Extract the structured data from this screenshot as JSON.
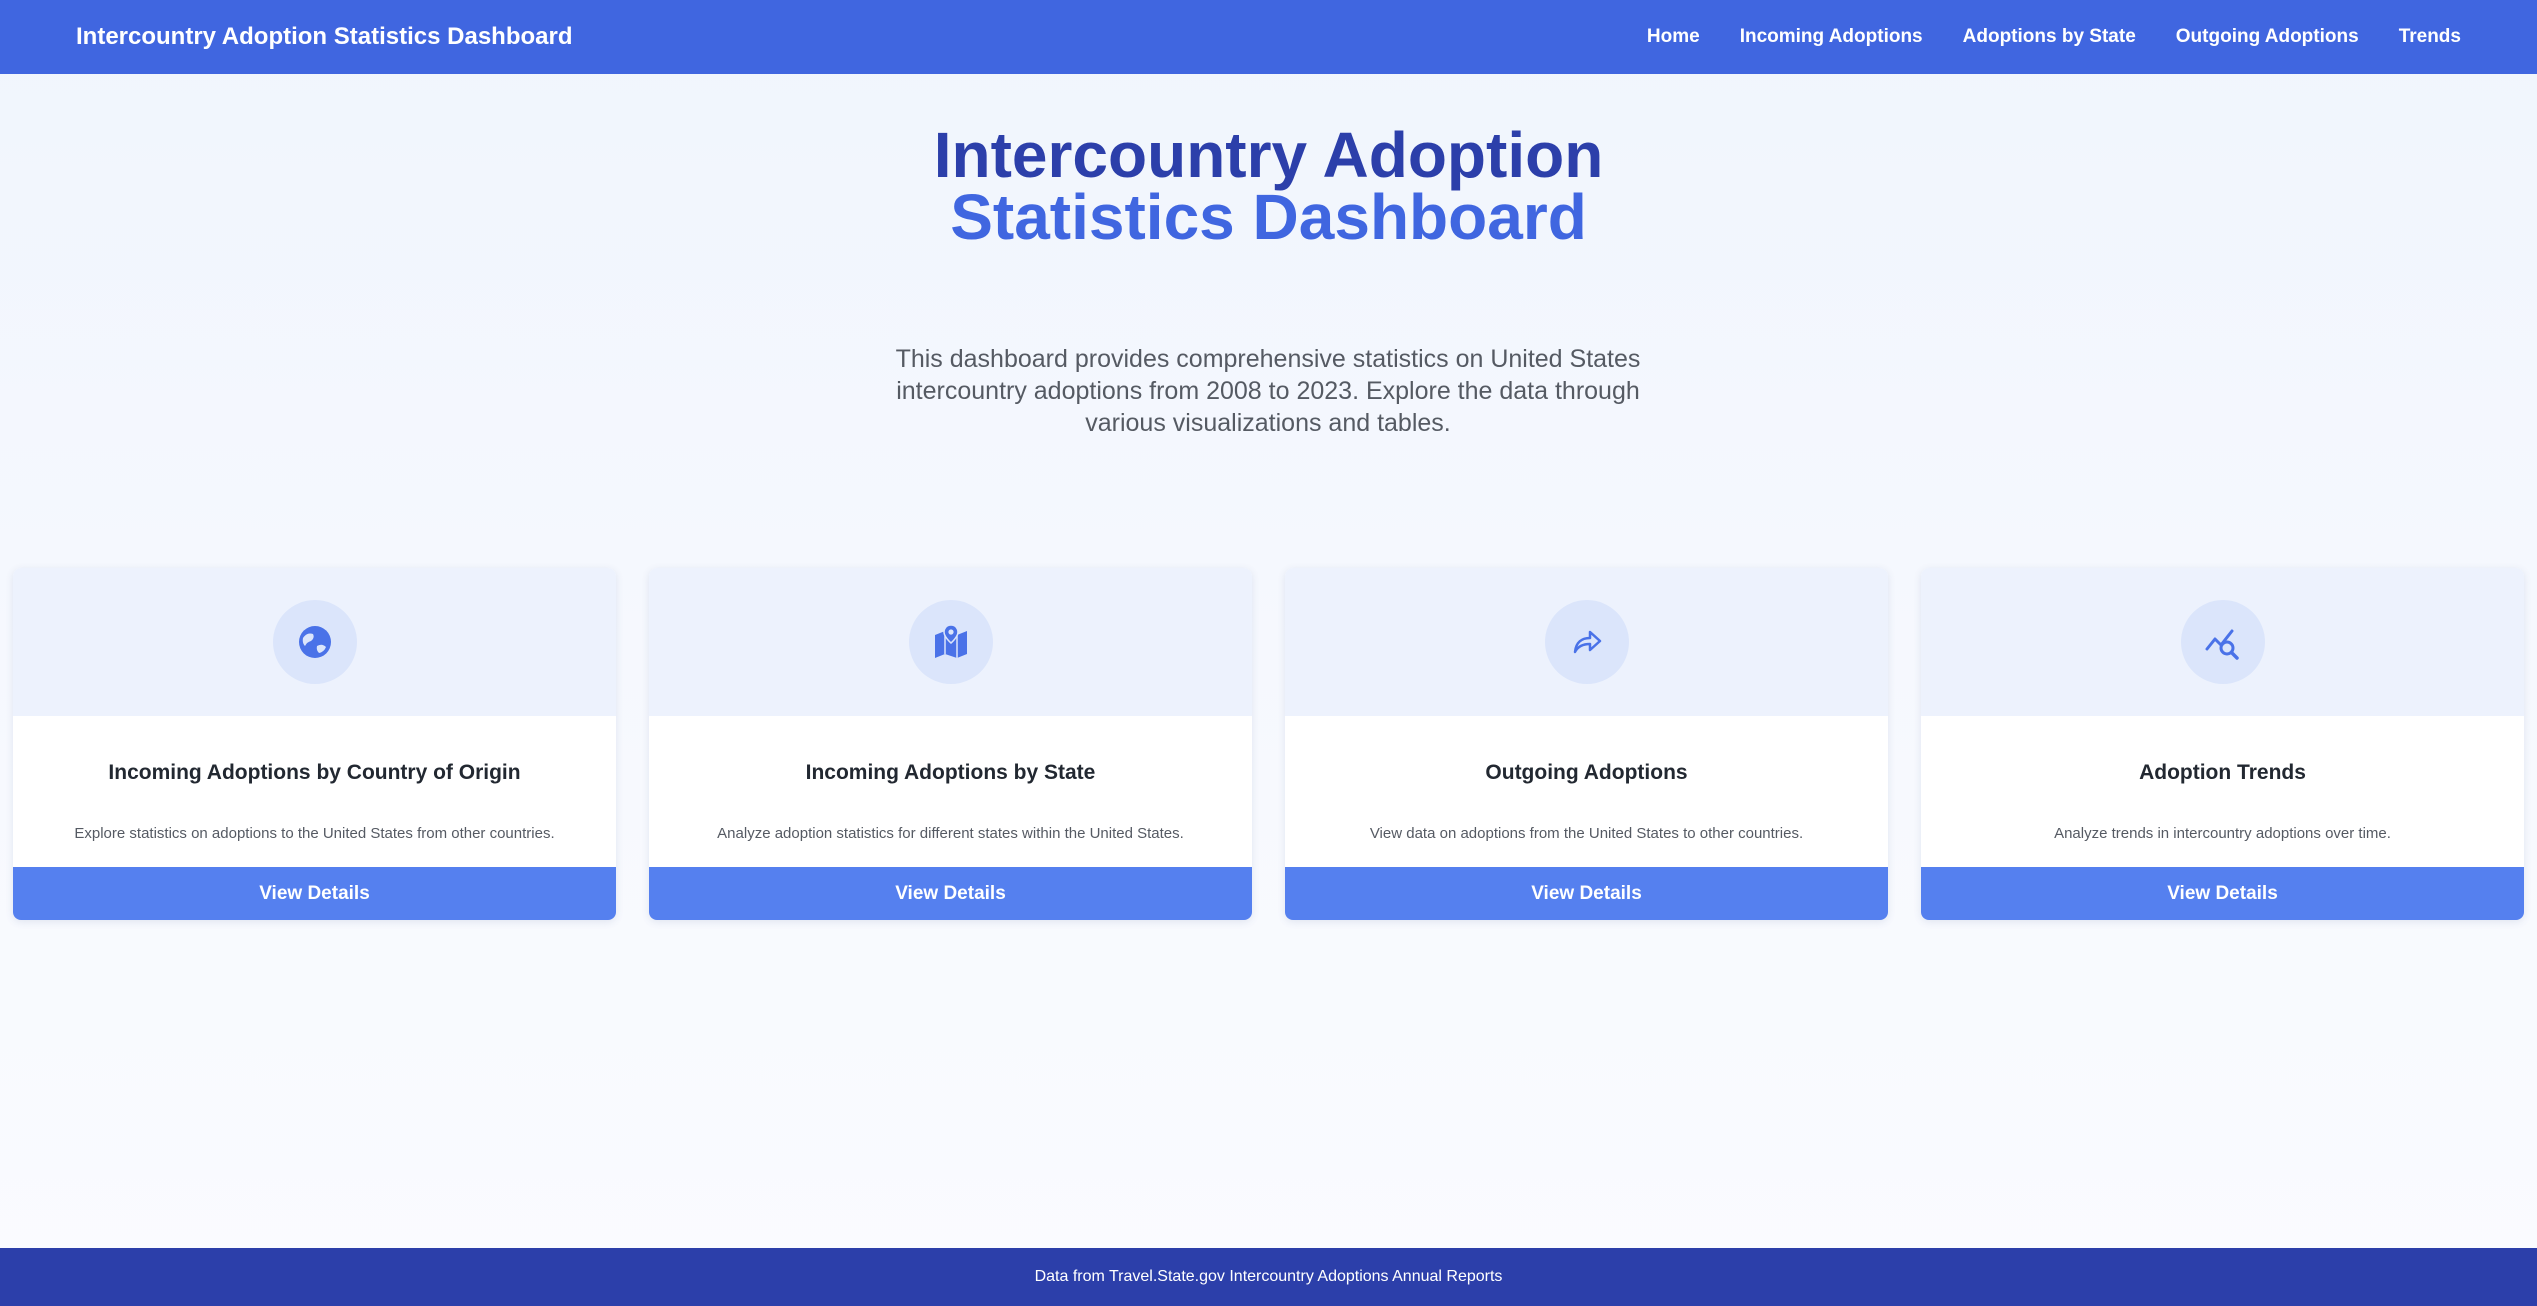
{
  "nav": {
    "brand": "Intercountry Adoption Statistics Dashboard",
    "links": [
      "Home",
      "Incoming Adoptions",
      "Adoptions by State",
      "Outgoing Adoptions",
      "Trends"
    ]
  },
  "hero": {
    "title_line1": "Intercountry Adoption",
    "title_line2": "Statistics Dashboard",
    "description": "This dashboard provides comprehensive statistics on United States intercountry adoptions from 2008 to 2023. Explore the data through various visualizations and tables."
  },
  "cards": [
    {
      "icon": "globe-icon",
      "title": "Incoming Adoptions by Country of Origin",
      "description": "Explore statistics on adoptions to the United States from other countries.",
      "button": "View Details"
    },
    {
      "icon": "map-pin-icon",
      "title": "Incoming Adoptions by State",
      "description": "Analyze adoption statistics for different states within the United States.",
      "button": "View Details"
    },
    {
      "icon": "share-arrow-icon",
      "title": "Outgoing Adoptions",
      "description": "View data on adoptions from the United States to other countries.",
      "button": "View Details"
    },
    {
      "icon": "chart-search-icon",
      "title": "Adoption Trends",
      "description": "Analyze trends in intercountry adoptions over time.",
      "button": "View Details"
    }
  ],
  "footer": {
    "text": "Data from Travel.State.gov Intercountry Adoptions Annual Reports"
  },
  "colors": {
    "nav_bg": "#4066e0",
    "title_dark": "#2c3faa",
    "title_accent": "#4066e0",
    "button_bg": "#5580ef",
    "footer_bg": "#2c3faa"
  }
}
